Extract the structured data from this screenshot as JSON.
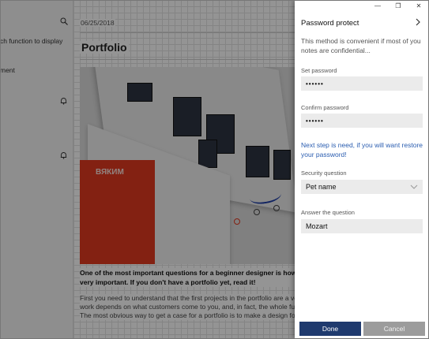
{
  "window": {
    "minimize_glyph": "—",
    "maximize_glyph": "❐",
    "close_glyph": "✕"
  },
  "sidebar": {
    "search_icon": "search-icon",
    "text_line1": "ch function to display",
    "text_line2": "ment",
    "bell_icon": "bell-icon"
  },
  "note": {
    "date": "06/25/2018",
    "title": "Portfolio",
    "image_red_text": "ВЯКИМ",
    "bold_line1": "One of the most important questions for a beginner designer is how to fill yo",
    "bold_line2": "very important. If you don't have a portfolio yet, read it!",
    "body_line1": "First you need to understand that the first projects in the portfolio are a very, ve",
    "body_line2": "work depends on what customers come to you, and, in fact, the whole further p",
    "body_line3": "The most obvious way to get a case for a portfolio is to make a design for your"
  },
  "panel": {
    "title": "Password protect",
    "description": "This method is convenient if most of you notes are confidential...",
    "set_password_label": "Set password",
    "set_password_value": "••••••",
    "confirm_password_label": "Confirm password",
    "confirm_password_value": "••••••",
    "hint": "Next step is need, if you will want restore your password!",
    "security_question_label": "Security question",
    "security_question_value": "Pet name",
    "answer_label": "Answer the question",
    "answer_value": "Mozart",
    "done_label": "Done",
    "cancel_label": "Cancel"
  },
  "colors": {
    "accent": "#1f3a6e",
    "link": "#2a5db0",
    "cancel": "#9c9c9c",
    "image_red": "#e2391f"
  }
}
